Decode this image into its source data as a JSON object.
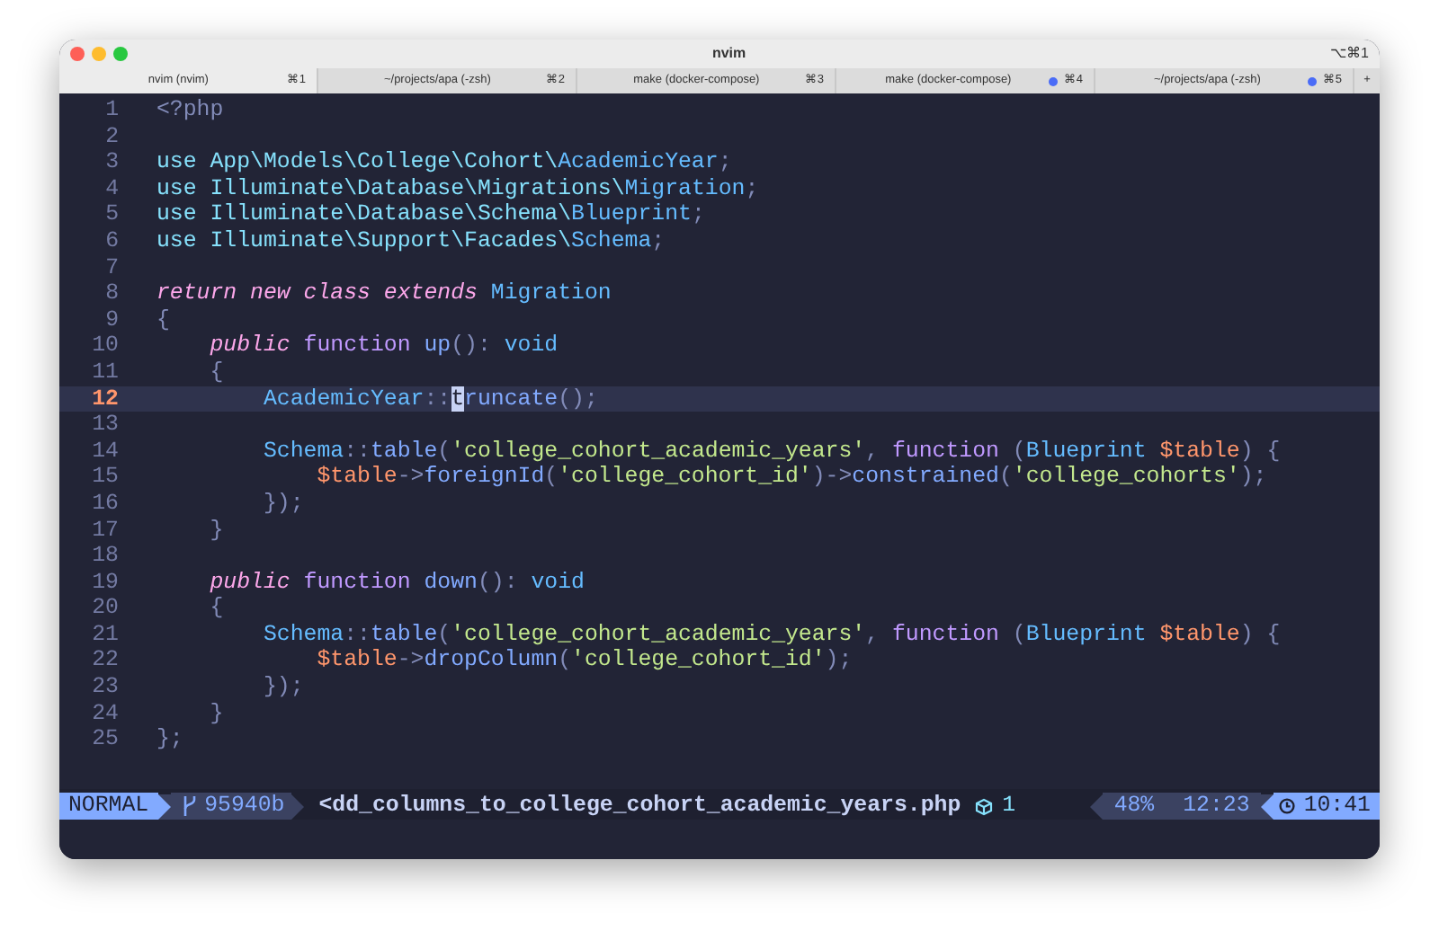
{
  "window": {
    "title": "nvim",
    "shortcut": "⌥⌘1"
  },
  "tabs": [
    {
      "label": "nvim (nvim)",
      "shortcut": "⌘1",
      "selected": true,
      "activity": false
    },
    {
      "label": "~/projects/apa (-zsh)",
      "shortcut": "⌘2",
      "selected": false,
      "activity": false
    },
    {
      "label": "make (docker-compose)",
      "shortcut": "⌘3",
      "selected": false,
      "activity": false
    },
    {
      "label": "make (docker-compose)",
      "shortcut": "⌘4",
      "selected": false,
      "activity": true
    },
    {
      "label": "~/projects/apa (-zsh)",
      "shortcut": "⌘5",
      "selected": false,
      "activity": true
    }
  ],
  "new_tab": "+",
  "lines": [
    {
      "number": "1",
      "current": false,
      "tokens": [
        {
          "text": "<?php",
          "kind": "tag"
        }
      ]
    },
    {
      "number": "2",
      "current": false
    },
    {
      "number": "3",
      "current": false,
      "tokens": [
        {
          "text": "use",
          "kind": "use"
        },
        {
          "text": " App\\Models\\College\\Cohort\\",
          "kind": "ns"
        },
        {
          "text": "AcademicYear",
          "kind": "type"
        },
        {
          "text": ";",
          "kind": "punc"
        }
      ]
    },
    {
      "number": "4",
      "current": false,
      "tokens": [
        {
          "text": "use",
          "kind": "use"
        },
        {
          "text": " Illuminate\\Database\\Migrations\\",
          "kind": "ns"
        },
        {
          "text": "Migration",
          "kind": "type"
        },
        {
          "text": ";",
          "kind": "punc"
        }
      ]
    },
    {
      "number": "5",
      "current": false,
      "tokens": [
        {
          "text": "use",
          "kind": "use"
        },
        {
          "text": " Illuminate\\Database\\Schema\\",
          "kind": "ns"
        },
        {
          "text": "Blueprint",
          "kind": "type"
        },
        {
          "text": ";",
          "kind": "punc"
        }
      ]
    },
    {
      "number": "6",
      "current": false,
      "tokens": [
        {
          "text": "use",
          "kind": "use"
        },
        {
          "text": " Illuminate\\Support\\Facades\\",
          "kind": "ns"
        },
        {
          "text": "Schema",
          "kind": "type"
        },
        {
          "text": ";",
          "kind": "punc"
        }
      ]
    },
    {
      "number": "7",
      "current": false
    },
    {
      "number": "8",
      "current": false,
      "tokens": [
        {
          "text": "return new class extends",
          "kind": "kwi"
        },
        {
          "text": " Migration",
          "kind": "type"
        }
      ]
    },
    {
      "number": "9",
      "current": false,
      "tokens": [
        {
          "text": "{",
          "kind": "punc"
        }
      ]
    },
    {
      "number": "10",
      "current": false,
      "tokens": [
        {
          "text": "    public",
          "kind": "kwi"
        },
        {
          "text": " function",
          "kind": "kw"
        },
        {
          "text": " up",
          "kind": "fn"
        },
        {
          "text": "():",
          "kind": "punc"
        },
        {
          "text": " void",
          "kind": "type"
        }
      ]
    },
    {
      "number": "11",
      "current": false,
      "tokens": [
        {
          "text": "    {",
          "kind": "punc"
        }
      ]
    },
    {
      "number": "12",
      "current": true,
      "tokens": [
        {
          "text": "        AcademicYear",
          "kind": "type"
        },
        {
          "text": "::",
          "kind": "punc"
        },
        {
          "text": "t",
          "kind": "fn",
          "cursor": true
        },
        {
          "text": "runcate",
          "kind": "fn"
        },
        {
          "text": "();",
          "kind": "punc"
        }
      ]
    },
    {
      "number": "13",
      "current": false
    },
    {
      "number": "14",
      "current": false,
      "tokens": [
        {
          "text": "        Schema",
          "kind": "type"
        },
        {
          "text": "::",
          "kind": "punc"
        },
        {
          "text": "table",
          "kind": "fn"
        },
        {
          "text": "(",
          "kind": "punc"
        },
        {
          "text": "'college_cohort_academic_years'",
          "kind": "str"
        },
        {
          "text": ",",
          "kind": "punc"
        },
        {
          "text": " function",
          "kind": "kw"
        },
        {
          "text": " (",
          "kind": "punc"
        },
        {
          "text": "Blueprint",
          "kind": "type"
        },
        {
          "text": " $table",
          "kind": "var"
        },
        {
          "text": ") {",
          "kind": "punc"
        }
      ]
    },
    {
      "number": "15",
      "current": false,
      "tokens": [
        {
          "text": "            $table",
          "kind": "var"
        },
        {
          "text": "->",
          "kind": "punc"
        },
        {
          "text": "foreignId",
          "kind": "fn"
        },
        {
          "text": "(",
          "kind": "punc"
        },
        {
          "text": "'college_cohort_id'",
          "kind": "str"
        },
        {
          "text": ")->",
          "kind": "punc"
        },
        {
          "text": "constrained",
          "kind": "fn"
        },
        {
          "text": "(",
          "kind": "punc"
        },
        {
          "text": "'college_cohorts'",
          "kind": "str"
        },
        {
          "text": ");",
          "kind": "punc"
        }
      ]
    },
    {
      "number": "16",
      "current": false,
      "tokens": [
        {
          "text": "        });",
          "kind": "punc"
        }
      ]
    },
    {
      "number": "17",
      "current": false,
      "tokens": [
        {
          "text": "    }",
          "kind": "punc"
        }
      ]
    },
    {
      "number": "18",
      "current": false
    },
    {
      "number": "19",
      "current": false,
      "tokens": [
        {
          "text": "    public",
          "kind": "kwi"
        },
        {
          "text": " function",
          "kind": "kw"
        },
        {
          "text": " down",
          "kind": "fn"
        },
        {
          "text": "():",
          "kind": "punc"
        },
        {
          "text": " void",
          "kind": "type"
        }
      ]
    },
    {
      "number": "20",
      "current": false,
      "tokens": [
        {
          "text": "    {",
          "kind": "punc"
        }
      ]
    },
    {
      "number": "21",
      "current": false,
      "tokens": [
        {
          "text": "        Schema",
          "kind": "type"
        },
        {
          "text": "::",
          "kind": "punc"
        },
        {
          "text": "table",
          "kind": "fn"
        },
        {
          "text": "(",
          "kind": "punc"
        },
        {
          "text": "'college_cohort_academic_years'",
          "kind": "str"
        },
        {
          "text": ",",
          "kind": "punc"
        },
        {
          "text": " function",
          "kind": "kw"
        },
        {
          "text": " (",
          "kind": "punc"
        },
        {
          "text": "Blueprint",
          "kind": "type"
        },
        {
          "text": " $table",
          "kind": "var"
        },
        {
          "text": ") {",
          "kind": "punc"
        }
      ]
    },
    {
      "number": "22",
      "current": false,
      "tokens": [
        {
          "text": "            $table",
          "kind": "var"
        },
        {
          "text": "->",
          "kind": "punc"
        },
        {
          "text": "dropColumn",
          "kind": "fn"
        },
        {
          "text": "(",
          "kind": "punc"
        },
        {
          "text": "'college_cohort_id'",
          "kind": "str"
        },
        {
          "text": ");",
          "kind": "punc"
        }
      ]
    },
    {
      "number": "23",
      "current": false,
      "tokens": [
        {
          "text": "        });",
          "kind": "punc"
        }
      ]
    },
    {
      "number": "24",
      "current": false,
      "tokens": [
        {
          "text": "    }",
          "kind": "punc"
        }
      ]
    },
    {
      "number": "25",
      "current": false,
      "tokens": [
        {
          "text": "};",
          "kind": "punc"
        }
      ]
    }
  ],
  "status_bar": {
    "mode": "NORMAL",
    "commit": "95940b",
    "file": "<dd_columns_to_college_cohort_academic_years.php",
    "diagnostics": "1",
    "percent": "48%",
    "position": "12:23",
    "time": "10:41"
  }
}
